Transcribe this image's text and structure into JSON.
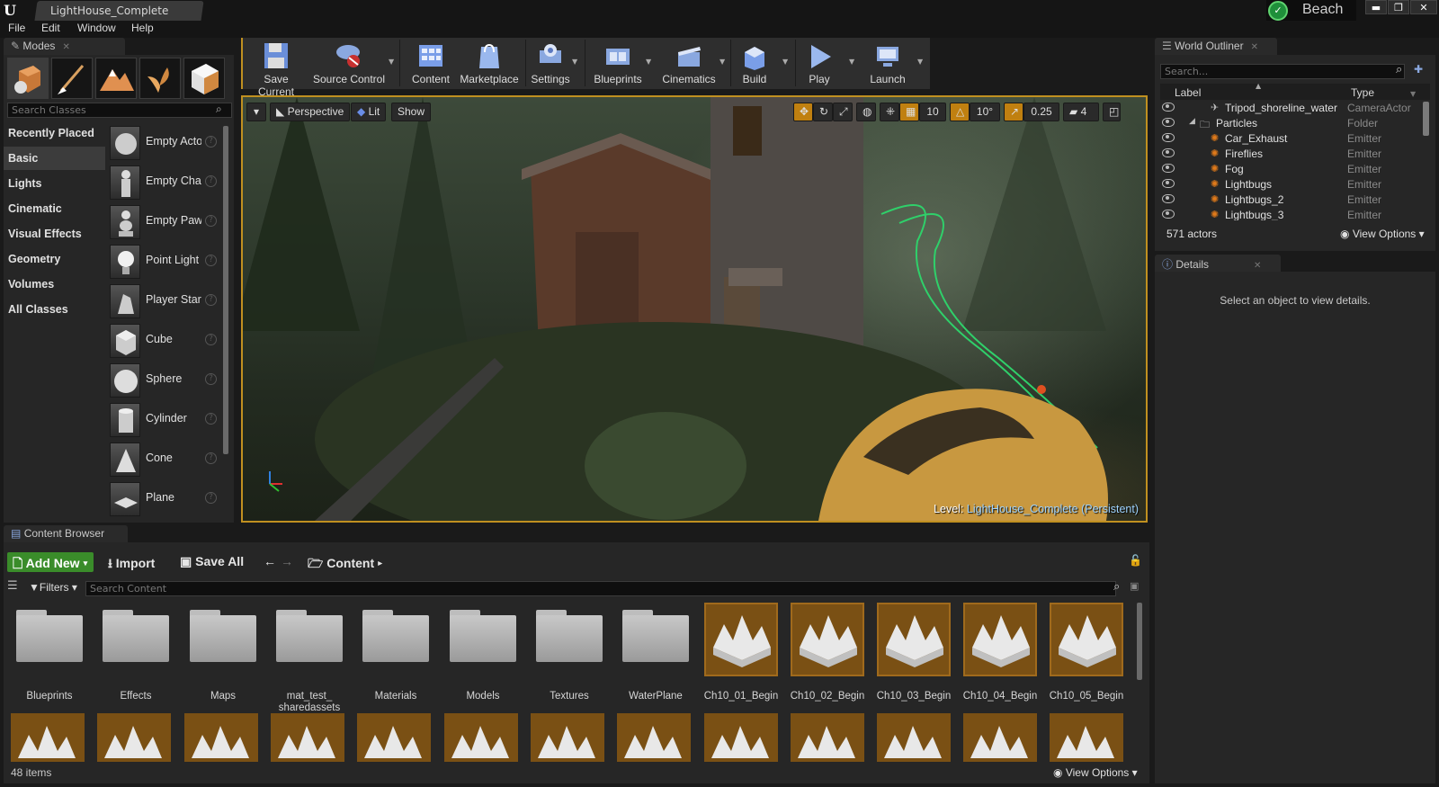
{
  "window": {
    "doc_tab": "LightHouse_Complete",
    "user": "Beach",
    "min": "▬",
    "max": "❐",
    "close": "✕"
  },
  "menu": [
    "File",
    "Edit",
    "Window",
    "Help"
  ],
  "modes": {
    "tab": "Modes",
    "search_placeholder": "Search Classes",
    "mode_icons": [
      "place-mode-icon",
      "paint-mode-icon",
      "landscape-mode-icon",
      "foliage-mode-icon",
      "geometry-mode-icon"
    ],
    "categories": [
      "Recently Placed",
      "Basic",
      "Lights",
      "Cinematic",
      "Visual Effects",
      "Geometry",
      "Volumes",
      "All Classes"
    ],
    "active_category": "Basic",
    "classes": [
      "Empty Actor",
      "Empty Character",
      "Empty Pawn",
      "Point Light",
      "Player Start",
      "Cube",
      "Sphere",
      "Cylinder",
      "Cone",
      "Plane"
    ]
  },
  "toolbar": [
    {
      "label": "Save Current",
      "icon": "save-icon"
    },
    {
      "label": "Source Control",
      "icon": "source-control-icon"
    },
    {
      "label": "Content",
      "icon": "content-icon"
    },
    {
      "label": "Marketplace",
      "icon": "marketplace-icon"
    },
    {
      "label": "Settings",
      "icon": "settings-icon"
    },
    {
      "label": "Blueprints",
      "icon": "blueprints-icon"
    },
    {
      "label": "Cinematics",
      "icon": "cinematics-icon"
    },
    {
      "label": "Build",
      "icon": "build-icon"
    },
    {
      "label": "Play",
      "icon": "play-icon"
    },
    {
      "label": "Launch",
      "icon": "launch-icon"
    }
  ],
  "viewport": {
    "perspective": "Perspective",
    "lit": "Lit",
    "show": "Show",
    "grid_snap": "10",
    "rot_snap": "10°",
    "scale_snap": "0.25",
    "camera_speed": "4",
    "level_prefix": "Level:",
    "level_name": "LightHouse_Complete (Persistent)"
  },
  "content_browser": {
    "tab": "Content Browser",
    "add_new": "Add New",
    "import": "Import",
    "save_all": "Save All",
    "path": "Content",
    "filters": "Filters",
    "search_placeholder": "Search Content",
    "folders": [
      "Blueprints",
      "Effects",
      "Maps",
      "mat_test_ sharedassets",
      "Materials",
      "Models",
      "Textures",
      "WaterPlane"
    ],
    "maps": [
      "Ch10_01_Begin",
      "Ch10_02_Begin",
      "Ch10_03_Begin",
      "Ch10_04_Begin",
      "Ch10_05_Begin"
    ],
    "items_count": "48 items",
    "view_options": "View Options"
  },
  "outliner": {
    "tab": "World Outliner",
    "search_placeholder": "Search...",
    "col_label": "Label",
    "col_type": "Type",
    "rows": [
      {
        "name": "Tripod_shoreline_water",
        "type": "CameraActor"
      },
      {
        "name": "Particles",
        "type": "Folder"
      },
      {
        "name": "Car_Exhaust",
        "type": "Emitter"
      },
      {
        "name": "Fireflies",
        "type": "Emitter"
      },
      {
        "name": "Fog",
        "type": "Emitter"
      },
      {
        "name": "Lightbugs",
        "type": "Emitter"
      },
      {
        "name": "Lightbugs_2",
        "type": "Emitter"
      },
      {
        "name": "Lightbugs_3",
        "type": "Emitter"
      }
    ],
    "actors_count": "571 actors",
    "view_options": "View Options"
  },
  "details": {
    "tab": "Details",
    "message": "Select an object to view details."
  },
  "colors": {
    "accent": "#c09020",
    "add_new": "#3a8c2a",
    "emitter_icon": "#e07a1a",
    "level_name": "#9ed3ff"
  }
}
